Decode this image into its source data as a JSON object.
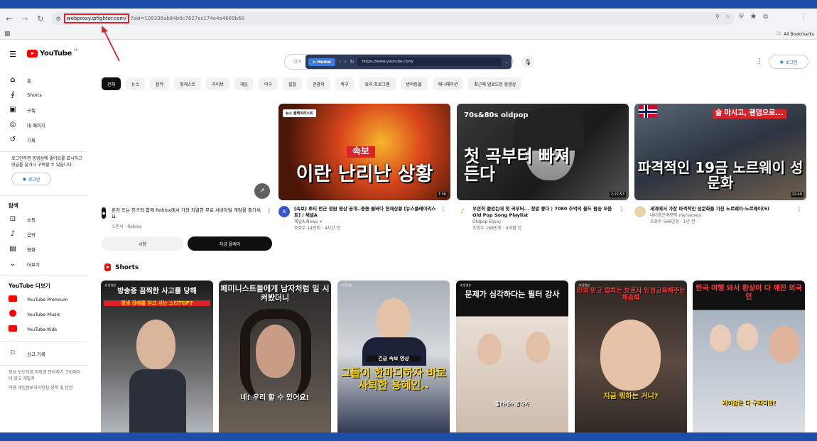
{
  "browser": {
    "url_host": "webproxy.ipfighter.com/",
    "url_rest": "?sid=109336ab84b0c7627ec174e4a4669b60",
    "bookmarks_label": "All Bookmarks"
  },
  "masthead": {
    "logo_text": "YouTube",
    "logo_region": "KR",
    "search_placeholder": "검색",
    "proxy_home": "Home",
    "proxy_url": "https://www.youtube.com/",
    "login_label": "로그인"
  },
  "sidebar": {
    "items": [
      {
        "icon": "home-icon",
        "label": "홈"
      },
      {
        "icon": "shorts-icon",
        "label": "Shorts"
      },
      {
        "icon": "subscriptions-icon",
        "label": "구독"
      },
      {
        "icon": "you-icon",
        "label": "내 페이지"
      },
      {
        "icon": "history-icon",
        "label": "기록"
      }
    ],
    "login_prompt": "로그인하면 동영상에 좋아요를 표시하고 댓글을 달거나 구독할 수 있습니다.",
    "login_label": "로그인",
    "explore_header": "탐색",
    "explore_items": [
      {
        "icon": "shopping-icon",
        "label": "쇼핑"
      },
      {
        "icon": "music-icon",
        "label": "음악"
      },
      {
        "icon": "movie-icon",
        "label": "영화"
      },
      {
        "icon": "chevron-down-icon",
        "label": "더보기"
      }
    ],
    "more_header": "YouTube 더보기",
    "more_items": [
      {
        "label": "YouTube Premium",
        "color": "#ff0000"
      },
      {
        "label": "YouTube Music",
        "color": "#ff0000"
      },
      {
        "label": "YouTube Kids",
        "color": "#ff0000"
      }
    ],
    "report_label": "신고 기록",
    "footer1": "정보 보도자료 저작권 문의하기 크리에이터 광고 개발자",
    "footer2": "약관 개인정보처리방침 정책 및 안전"
  },
  "chips": [
    "전체",
    "뉴스",
    "음악",
    "팟캐스트",
    "라이브",
    "게임",
    "야구",
    "힙합",
    "관광지",
    "축구",
    "요리 프로그램",
    "반려동물",
    "애니메이션",
    "최근에 업로드된 동영상"
  ],
  "ad": {
    "title": "혼자 또는 친구와 함께 Roblox에서 가장 치열한 무료 서바이벌 게임을 즐기세요",
    "sponsor": "스폰서 · Roblox",
    "btn_watch": "시청",
    "btn_play": "지금 플레이"
  },
  "videos": [
    {
      "thumb_caption": "이란 난리난 상황",
      "thumb_tag": "속보",
      "thumb_badge": "뉴스 플레이리스트",
      "duration": "7:36",
      "title": "[속보] 루티 반군 정원 영상 공개..중동 불바다 현재상황 [뉴스플레이리스트] / 채널A",
      "channel": "채널A News",
      "stats": "조회수 14만회 · 4시간 전"
    },
    {
      "thumb_caption": "첫 곡부터 빠져든다",
      "thumb_top": "70s&80s oldpop",
      "duration": "2:22:53",
      "title": "우연히 들었는데 첫 곡부터... 정말 좋다 | 7080 추억의 올드 팝송 모음 Old Pop Song Playlist",
      "channel": "Oldpop Essay",
      "stats": "조회수 168만회 · 4개월 전"
    },
    {
      "thumb_caption": "파격적인 19금 노르웨이 성문화",
      "thumb_top": "술 마시고, 랜덤으로...",
      "duration": "22:40",
      "title": "세계에서 가장 파격적인 성문화를 가진 노르웨이-노르웨이(5)",
      "channel": "내이름은여행작 mynamejs",
      "stats": "조회수 566만회 · 1년 전"
    }
  ],
  "shorts_header": "Shorts",
  "shorts": [
    {
      "tag": "새 동영상",
      "top": "방송중 끔찍한 사고를 당해",
      "sub": "평생 장애를 얻고 사는 스타TOP7",
      "bottom": ""
    },
    {
      "tag": "새 동영상",
      "top": "페미니스트들에게 남자처럼 일 시켜봤더니",
      "sub": "",
      "bottom": "네! 우리 할 수 있어요!"
    },
    {
      "tag": "새 동영상",
      "top": "",
      "sub": "긴급 속보 영상",
      "bottom": "그들이 한마디하자 바로 사퇴한 용혜인.."
    },
    {
      "tag": "새 동영상",
      "top": "문제가 심각하다는 필터 강사",
      "sub": "",
      "bottom": "필라테스 강사가"
    },
    {
      "tag": "새 동영상",
      "top": "인맥 믿고 깝치는 보호자 인성교육해주는 채송화",
      "sub": "",
      "bottom": "지금 뭐하는 거니?"
    },
    {
      "tag": "",
      "top": "한국 여행 와서 환상이 다 깨진 외국인",
      "sub": "",
      "bottom": "케이팝은 다 구라더만!"
    }
  ]
}
